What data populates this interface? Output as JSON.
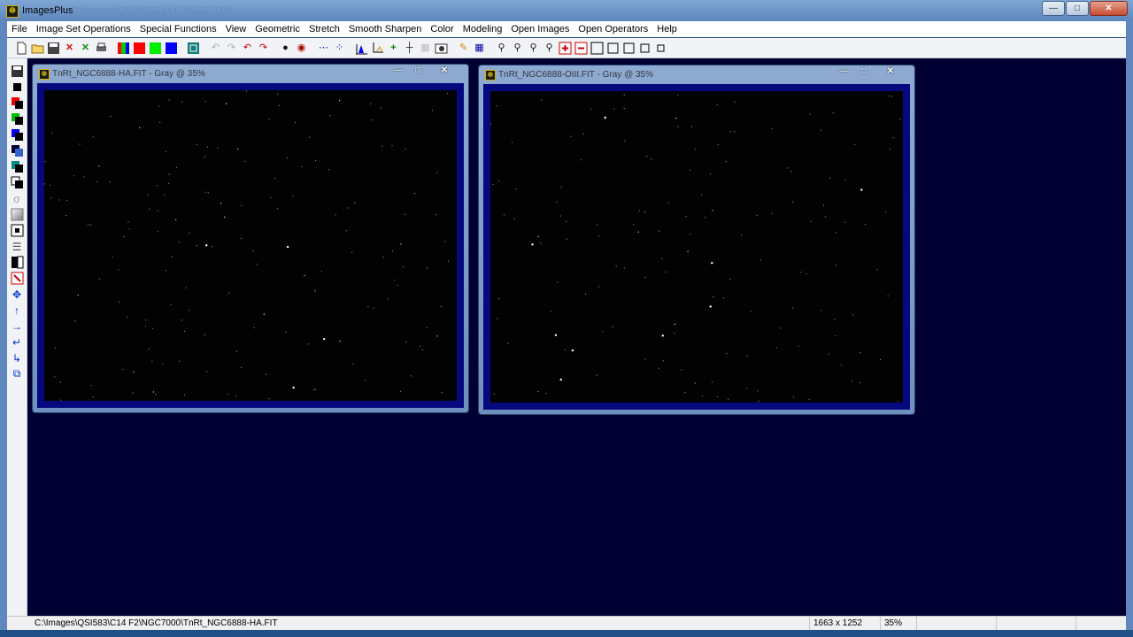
{
  "window": {
    "title": "ImagesPlus",
    "ghost_title": "C:\\Images\\QSI583\\C14 F2\\NGC7000",
    "icon": "app-icon",
    "controls": [
      "minimize-icon",
      "maximize-icon",
      "close-icon"
    ]
  },
  "menu": {
    "items": [
      {
        "label": "File"
      },
      {
        "label": "Image Set Operations"
      },
      {
        "label": "Special Functions"
      },
      {
        "label": "View"
      },
      {
        "label": "Geometric"
      },
      {
        "label": "Stretch"
      },
      {
        "label": "Smooth Sharpen"
      },
      {
        "label": "Color"
      },
      {
        "label": "Modeling"
      },
      {
        "label": "Open Images"
      },
      {
        "label": "Open Operators"
      },
      {
        "label": "Help"
      }
    ]
  },
  "toolbar": {
    "icons": [
      "new-file-icon",
      "open-folder-icon",
      "save-icon",
      "close-image-icon",
      "close-all-icon",
      "print-icon",
      "rgb-channels-icon",
      "red-channel-icon",
      "green-channel-icon",
      "blue-channel-icon",
      "luminance-icon",
      "undo-icon",
      "redo-icon",
      "undo-all-icon",
      "redo-all-icon",
      "point-icon",
      "target-icon",
      "line-profile-icon",
      "star-profile-icon",
      "histogram-icon",
      "crop-icon",
      "crosshair-icon",
      "registration-icon",
      "grid-icon",
      "color-picker-icon",
      "edit-icon",
      "table-icon",
      "zoom-in-icon",
      "zoom-out-icon",
      "zoom-fit-icon",
      "zoom-100-icon",
      "zoom-plus-icon",
      "zoom-minus-icon",
      "frame-1-icon",
      "frame-2-icon",
      "frame-3-icon",
      "frame-4-icon",
      "frame-5-icon"
    ]
  },
  "left_tools": {
    "icons": [
      "save-tool-icon",
      "black-square-icon",
      "red-black-icon",
      "green-black-icon",
      "blue-black-icon",
      "blue-gray-icon",
      "cyan-black-icon",
      "white-black-icon",
      "sigma-icon",
      "gradient-icon",
      "frame-tool-icon",
      "list-tool-icon",
      "half-tone-icon",
      "selection-icon",
      "move-icon",
      "up-arrow-icon",
      "right-arrow-icon",
      "rotate-left-icon",
      "rotate-right-icon",
      "copy-icon"
    ]
  },
  "windows": [
    {
      "title": "TnRt_NGC6888-HA.FIT - Gray @ 35%",
      "controls": [
        "minimize-icon",
        "maximize-icon",
        "close-icon"
      ]
    },
    {
      "title": "TnRt_NGC6888-OIII.FIT - Gray @ 35%",
      "controls": [
        "minimize-icon",
        "maximize-icon",
        "close-icon"
      ]
    }
  ],
  "status": {
    "path": "C:\\Images\\QSI583\\C14 F2\\NGC7000\\TnRt_NGC6888-HA.FIT",
    "dimensions": "1663 x 1252",
    "zoom": "35%"
  }
}
